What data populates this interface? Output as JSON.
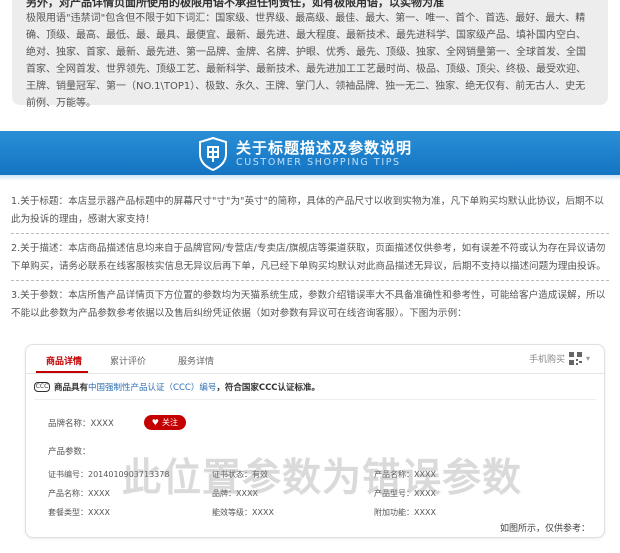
{
  "top_section": {
    "cut_heading": "另外，对产品详情页面所使用的极限用语不承担任何责任，如有极限用语，以实物为准",
    "text": "极限用语\"违禁词\"包含但不限于如下词汇：国家级、世界级、最高级、最佳、最大、第一、唯一、首个、首选、最好、最大、精确、顶级、最高、最低、最、最具、最便宜、最新、最先进、最大程度、最新技术、最先进科学、国家级产品、填补国内空白、绝对、独家、首家、最新、最先进、第一品牌、金牌、名牌、护眼、优秀、最先、顶级、独家、全网销量第一、全球首发、全国首家、全网首发、世界领先、顶级工艺、最新科学、最新技术、最先进加工工艺最时尚、极品、顶级、顶尖、终极、最受欢迎、王牌、销量冠军、第一（NO.1\\TOP1）、极致、永久、王牌、掌门人、领袖品牌、独一无二、独家、绝无仅有、前无古人、史无前例、万能等。"
  },
  "banner": {
    "title": "关于标题描述及参数说明",
    "subtitle": "CUSTOMER SHOPPING TIPS",
    "color_top": "#2a8fd6",
    "color_bottom": "#1474c2"
  },
  "notes": [
    "1.关于标题：本店显示器产品标题中的屏幕尺寸\"寸\"为\"英寸\"的简称，具体的产品尺寸以收到实物为准，凡下单购买均默认此协议，后期不以此为投诉的理由，感谢大家支持！",
    "2.关于描述：本店商品描述信息均来自于品牌官网/专营店/专卖店/旗舰店等渠道获取，页面描述仅供参考，如有误差不符或认为存在异议请勿下单购买，请务必联系在线客服核实信息无异议后再下单，凡已经下单购买均默认对此商品描述无异议，后期不支持以描述问题为理由投诉。",
    "3.关于参数：本店所售产品详情页下方位置的参数均为天猫系统生成，参数介绍错误率大不具备准确性和参考性，可能给客户造成误解，所以不能以此参数为产品参数参考依据以及售后纠纷凭证依据（如对参数有异议可在线咨询客服）。下图为示例："
  ],
  "demo": {
    "tabs": [
      "商品详情",
      "累计评价",
      "服务详情"
    ],
    "mobile_buy": "手机购买",
    "ccc_icon": "CCC",
    "ccc_prefix": "商品具有",
    "ccc_link": "中国强制性产品认证（CCC）编号",
    "ccc_suffix": "，符合国家CCC认证标准。",
    "brand_label": "品牌名称：XXXX",
    "follow_label": "关注",
    "params_title": "产品参数：",
    "params": [
      "证书编号：2014010903713378",
      "证书状态：有效",
      "产品名称：XXXX",
      "产品名称：XXXX",
      "品牌：XXXX",
      "产品型号：XXXX",
      "套餐类型：XXXX",
      "能效等级：XXXX",
      "附加功能：XXXX"
    ],
    "watermark": "此位置参数为错误参数",
    "caption": "如图所示，仅供参考：",
    "accent": "#c40000"
  }
}
